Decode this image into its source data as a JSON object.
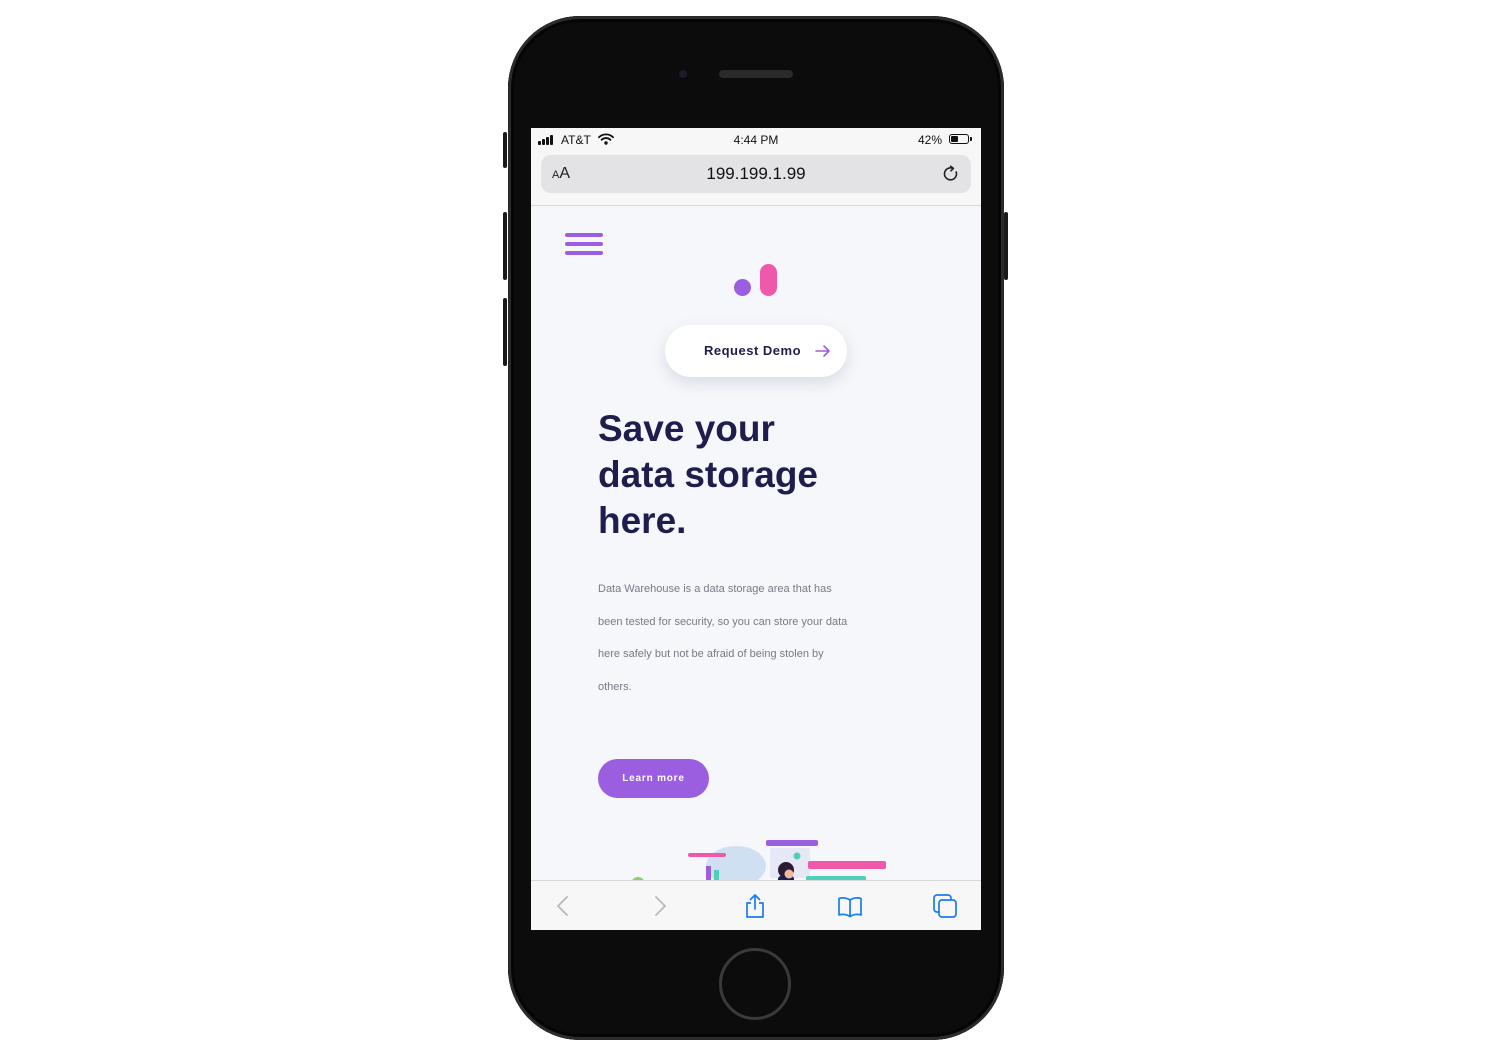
{
  "status_bar": {
    "carrier": "AT&T",
    "time": "4:44 PM",
    "battery_percent_label": "42%",
    "battery_level": 0.42,
    "icons": [
      "signal-icon",
      "wifi-icon",
      "battery-icon"
    ]
  },
  "browser": {
    "text_size_label": "AA",
    "url": "199.199.1.99",
    "icons": [
      "reload-icon",
      "back-icon",
      "forward-icon",
      "share-icon",
      "bookmarks-icon",
      "tabs-icon"
    ]
  },
  "page": {
    "menu_icon": "hamburger-menu-icon",
    "logo_icon": "brand-logo-icon",
    "request_demo_label": "Request Demo",
    "hero_title_lines": [
      "Save your",
      "data storage",
      "here."
    ],
    "hero_description": "Data Warehouse is a data storage area that has been tested for security, so you can store your data here safely but not be afraid of being stolen by others.",
    "learn_more_label": "Learn more",
    "colors": {
      "primary_purple": "#9b5ee0",
      "accent_pink": "#ee5aa9",
      "heading_navy": "#1f1d4e",
      "teal": "#4fcfb9",
      "background": "#f5f7fa"
    }
  }
}
